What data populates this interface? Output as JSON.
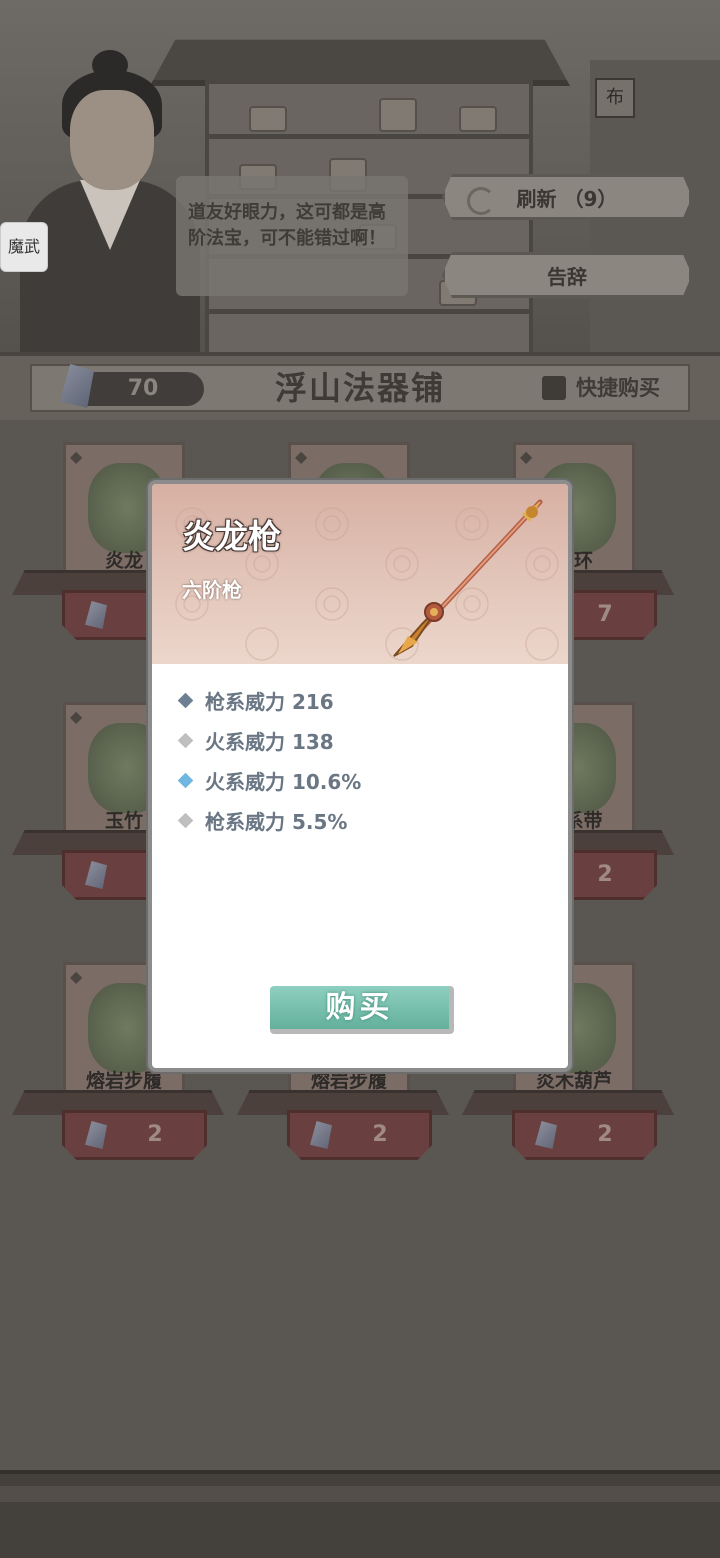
{
  "shop": {
    "dialog_text": "道友好眼力，这可都是高阶法宝，可不能错过啊！",
    "avatar_label": "魔武",
    "sign_text": "布",
    "refresh_label": "刷新 （9）",
    "leave_label": "告辞",
    "currency_value": "70",
    "title": "浮山法器铺",
    "quick_buy_label": "快捷购买"
  },
  "items": [
    {
      "name": "炎龙枪",
      "price": "",
      "type_icon": "spear-icon",
      "visible_name": "炎龙"
    },
    {
      "name": "",
      "price": "",
      "type_icon": "axe-icon",
      "visible_name": ""
    },
    {
      "name": "木环",
      "price": "7",
      "type_icon": "ring-icon",
      "visible_name": "木环"
    },
    {
      "name": "玉竹",
      "price": "",
      "type_icon": "armor-icon",
      "visible_name": "玉竹"
    },
    {
      "name": "",
      "price": "",
      "type_icon": "",
      "visible_name": ""
    },
    {
      "name": "披系带",
      "price": "2",
      "type_icon": "belt-icon",
      "visible_name": "披系带"
    },
    {
      "name": "熔岩步履",
      "price": "2",
      "type_icon": "boot-icon",
      "visible_name": "熔岩步履"
    },
    {
      "name": "熔岩步履",
      "price": "2",
      "type_icon": "boot-icon",
      "visible_name": "熔岩步履"
    },
    {
      "name": "炎木葫芦",
      "price": "2",
      "type_icon": "gourd-icon",
      "visible_name": "炎木葫芦"
    }
  ],
  "modal": {
    "title": "炎龙枪",
    "subtitle": "六阶枪",
    "stats": [
      {
        "text": "枪系威力 216",
        "bullet_color": "#6e7f93"
      },
      {
        "text": "火系威力 138",
        "bullet_color": "#bfbfbf"
      },
      {
        "text": "火系威力 10.6%",
        "bullet_color": "#6fb6e0"
      },
      {
        "text": "枪系威力 5.5%",
        "bullet_color": "#bfbfbf"
      }
    ],
    "buy_label": "购买"
  },
  "colors": {
    "accent_teal": "#63b09c",
    "modal_header": "#d7b0a3",
    "stat_text": "#6a7684"
  }
}
